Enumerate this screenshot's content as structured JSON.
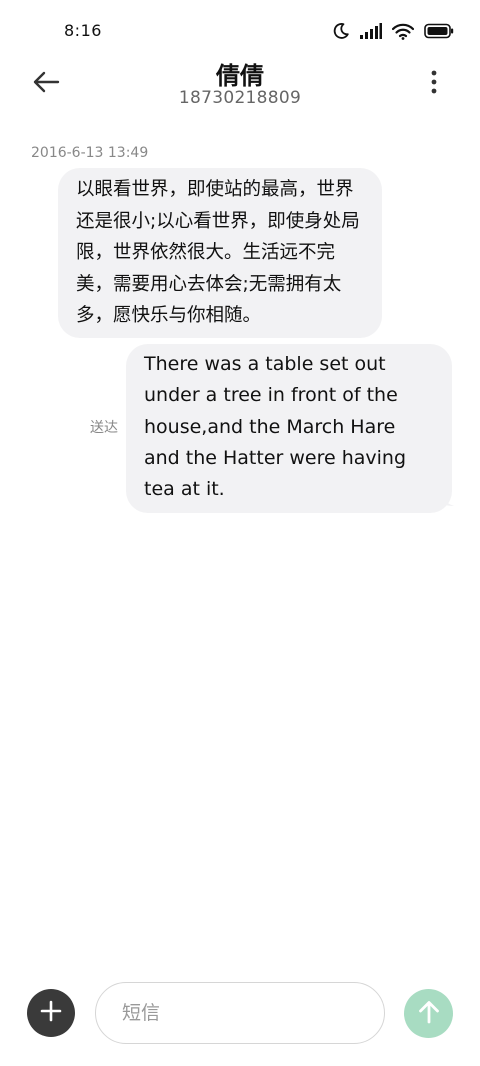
{
  "status_bar": {
    "time": "8:16",
    "icons": [
      "moon-icon",
      "signal-icon",
      "wifi-icon",
      "battery-icon"
    ]
  },
  "header": {
    "back_icon": "arrow-left-icon",
    "contact_name": "倩倩",
    "contact_number": "18730218809",
    "more_icon": "more-vertical-icon"
  },
  "conversation": {
    "timestamp": "2016-6-13 13:49",
    "incoming_message": "以眼看世界，即使站的最高，世界还是很小;以心看世界，即使身处局限，世界依然很大。生活远不完美，需要用心去体会;无需拥有太多，愿快乐与你相随。",
    "outgoing_message": "There was a table set out under a tree in front of the house,and the March Hare and the Hatter were having tea at it.",
    "delivery_status": "送达"
  },
  "composer": {
    "add_icon": "plus-icon",
    "placeholder": "短信",
    "send_icon": "arrow-up-icon",
    "send_color": "#a8dcc2",
    "add_color": "#3a3a3a"
  }
}
